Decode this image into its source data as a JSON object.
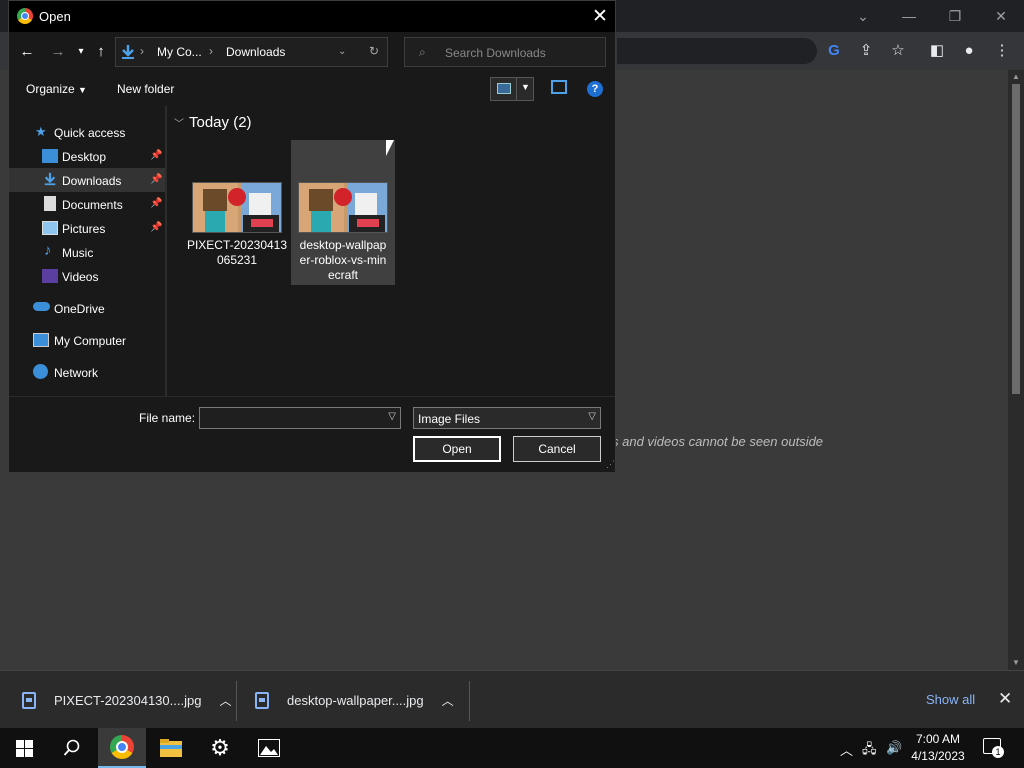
{
  "browser": {
    "page_text": "s and videos cannot be seen outside"
  },
  "dialog": {
    "title": "Open",
    "address": {
      "crumbs": [
        "My Co...",
        "Downloads"
      ]
    },
    "search_placeholder": "Search Downloads",
    "commands": {
      "organize": "Organize",
      "new_folder": "New folder"
    },
    "help_glyph": "?",
    "nav": {
      "quick_access": "Quick access",
      "items": [
        "Desktop",
        "Downloads",
        "Documents",
        "Pictures",
        "Music",
        "Videos"
      ],
      "onedrive": "OneDrive",
      "my_computer": "My Computer",
      "network": "Network"
    },
    "group_header": "Today (2)",
    "files": [
      {
        "name": "PIXECT-20230413065231",
        "lines": [
          "PIXECT-20230413",
          "065231"
        ]
      },
      {
        "name": "desktop-wallpaper-roblox-vs-minecraft",
        "lines": [
          "desktop-wallpap",
          "er-roblox-vs-min",
          "ecraft"
        ]
      }
    ],
    "file_name_label": "File name:",
    "file_name_value": "",
    "filter": "Image Files",
    "open_button": "Open",
    "cancel_button": "Cancel"
  },
  "downloads": {
    "items": [
      "PIXECT-202304130....jpg",
      "desktop-wallpaper....jpg"
    ],
    "show_all": "Show all"
  },
  "taskbar": {
    "time": "7:00 AM",
    "date": "4/13/2023",
    "notification_count": "1"
  },
  "colors": {
    "accent": "#8ab4f8",
    "dialog_bg": "#191919",
    "selection": "#404040"
  }
}
